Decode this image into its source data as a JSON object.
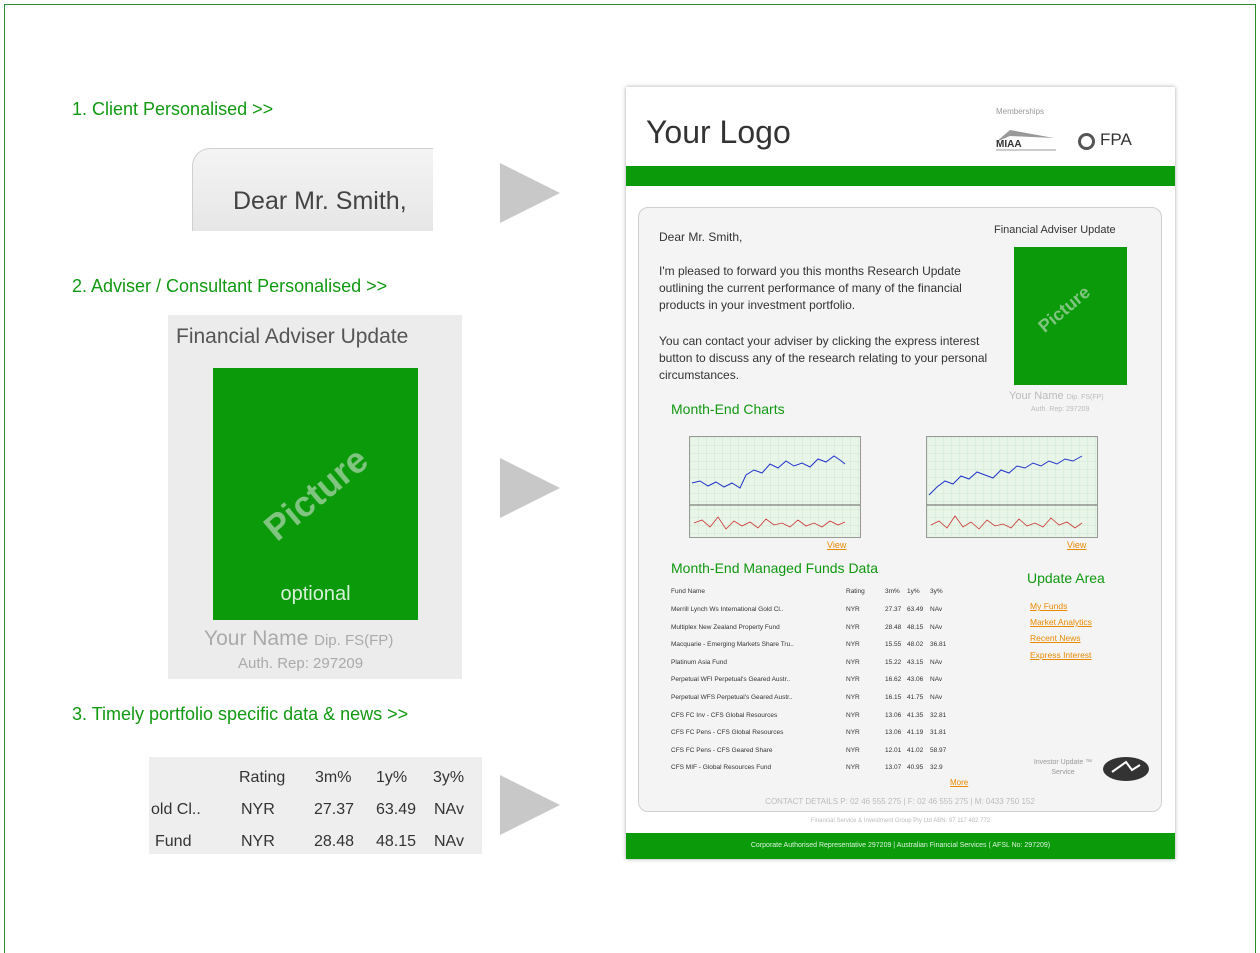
{
  "steps": [
    {
      "label": "1. Client Personalised >>"
    },
    {
      "label": "2. Adviser / Consultant Personalised >>"
    },
    {
      "label": "3. Timely portfolio specific data & news  >>"
    }
  ],
  "client_card": {
    "greeting": "Dear Mr. Smith,"
  },
  "adviser_card": {
    "title": "Financial Adviser Update",
    "picture_label": "Picture",
    "optional_label": "optional",
    "name": "Your Name",
    "qualification": "Dip. FS(FP)",
    "auth_rep": "Auth. Rep: 297209"
  },
  "data_preview": {
    "headers": [
      "Rating",
      "3m%",
      "1y%",
      "3y%"
    ],
    "rows": [
      [
        "old Cl..",
        "NYR",
        "27.37",
        "63.49",
        "NAv"
      ],
      [
        "Fund",
        "NYR",
        "28.48",
        "48.15",
        "NAv"
      ]
    ]
  },
  "document": {
    "logo": "Your Logo",
    "memberships_label": "Memberships",
    "miaa": "MIAA",
    "fpa": "FPA",
    "greeting": "Dear Mr. Smith,",
    "adviser_update": "Financial Adviser Update",
    "para1": "I'm pleased to forward you this months Research Update outlining the current performance of many of the financial products in your investment portfolio.",
    "para2": "You can contact your adviser by clicking the express interest button to discuss any of the research relating to your personal circumstances.",
    "picture_label": "Picture",
    "name": "Your Name",
    "qualification": "Dip. FS(FP)",
    "auth_rep": "Auth. Rep: 297209",
    "charts_heading": "Month-End Charts",
    "view_link": "View",
    "funds_heading": "Month-End Managed Funds Data",
    "funds_headers": [
      "Fund Name",
      "Rating",
      "3m%",
      "1y%",
      "3y%"
    ],
    "funds_rows": [
      [
        "Merrill Lynch Ws International Gold Cl..",
        "NYR",
        "27.37",
        "63.49",
        "NAv"
      ],
      [
        "Multiplex New Zealand Property Fund",
        "NYR",
        "28.48",
        "48.15",
        "NAv"
      ],
      [
        "Macquarie - Emerging Markets Share Tru..",
        "NYR",
        "15.55",
        "48.02",
        "36.81"
      ],
      [
        "Platinum Asia Fund",
        "NYR",
        "15.22",
        "43.15",
        "NAv"
      ],
      [
        "Perpetual WFI Perpetual's Geared Austr..",
        "NYR",
        "16.62",
        "43.06",
        "NAv"
      ],
      [
        "Perpetual WFS Perpetual's Geared Austr..",
        "NYR",
        "16.15",
        "41.75",
        "NAv"
      ],
      [
        "CFS FC Inv - CFS Global Resources",
        "NYR",
        "13.06",
        "41.35",
        "32.81"
      ],
      [
        "CFS FC Pens - CFS Global Resources",
        "NYR",
        "13.06",
        "41.19",
        "31.81"
      ],
      [
        "CFS FC Pens - CFS Geared Share",
        "NYR",
        "12.01",
        "41.02",
        "58.97"
      ],
      [
        "CFS MIF - Global Resources Fund",
        "NYR",
        "13.07",
        "40.95",
        "32.9"
      ]
    ],
    "more_link": "More",
    "update_area": {
      "heading": "Update Area",
      "links": [
        "My Funds",
        "Market Analytics",
        "Recent News",
        "Express Interest"
      ]
    },
    "service_badge": "Investor Update ™ Service",
    "contact": "CONTACT DETAILS  P: 02 46 555 275  |  F: 02 46 555 275  |  M: 0433 750 152",
    "company": "Financial Service & Investment Group Pty Ltd   ABN: 97 117 482 772",
    "footer": "Corporate Authorised Representative 297209  |  Australian Financial Services ( AFSL No: 297209)"
  }
}
